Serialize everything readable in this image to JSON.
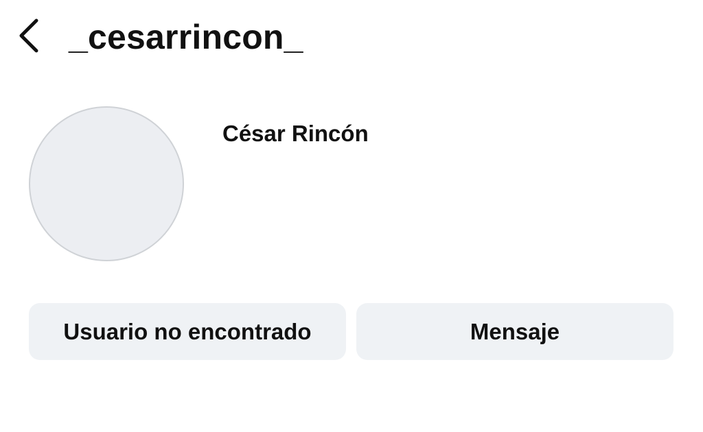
{
  "header": {
    "back_icon": "chevron-left-icon",
    "username": "_cesarrincon_"
  },
  "profile": {
    "display_name": "César Rincón",
    "avatar_color": "#eceef2"
  },
  "actions": {
    "status_label": "Usuario no encontrado",
    "message_label": "Mensaje"
  }
}
